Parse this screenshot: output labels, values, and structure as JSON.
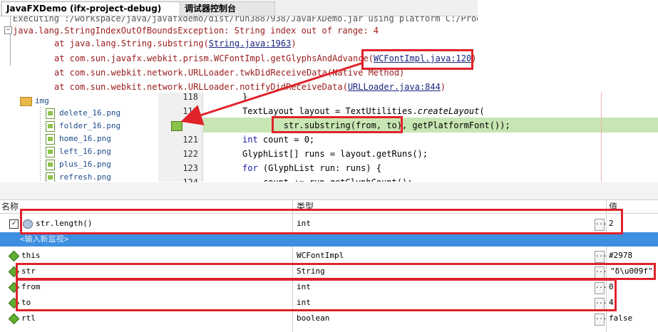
{
  "tabs": [
    {
      "label": "JavaFXDemo (ifx-project-debug)"
    },
    {
      "label": "调试器控制台"
    }
  ],
  "output": {
    "lines": [
      {
        "text": "Executing :/workspace/java/javafxdemo/dist/run3887938/JavaFXDemo.jar using platform C:/Prog"
      },
      {
        "text": "java.lang.StringIndexOutOfBoundsException: String index out of range: 4"
      },
      {
        "prefix": "\tat java.lang.String.substring(",
        "link": "String.java:1963",
        "suffix": ")"
      },
      {
        "prefix": "\tat com.sun.javafx.webkit.prism.WCFontImpl.getGlyphsAndAdvance(",
        "link": "WCFontImpl.java:120",
        "suffix": ")"
      },
      {
        "prefix": "\tat com.sun.webkit.network.URLLoader.twkDidReceiveData(Native Method)",
        "link": "",
        "suffix": ""
      },
      {
        "prefix": "\tat com.sun.webkit.network.URLLoader.notifyDidReceiveData(",
        "link": "URLLoader.java:844",
        "suffix": ")"
      }
    ]
  },
  "tree": {
    "folder": "img",
    "files": [
      "delete_16.png",
      "folder_16.png",
      "home_16.png",
      "left_16.png",
      "plus_16.png",
      "refresh.png"
    ]
  },
  "editor": {
    "line_numbers": [
      "118",
      "119",
      "",
      "121",
      "122",
      "123",
      "124"
    ],
    "lines": [
      {
        "parts": [
          {
            "t": "}",
            "c": ""
          }
        ]
      },
      {
        "parts": [
          {
            "t": "TextLayout layout = TextUtilities.",
            "c": ""
          },
          {
            "t": "createLayout",
            "c": "it"
          },
          {
            "t": "(",
            "c": ""
          }
        ]
      },
      {
        "parts": [
          {
            "t": "        str.substring(from, to), getPlatformFont());",
            "c": ""
          }
        ]
      },
      {
        "parts": [
          {
            "t": "int",
            "c": "kw"
          },
          {
            "t": " count = 0;",
            "c": ""
          }
        ]
      },
      {
        "parts": [
          {
            "t": "GlyphList[] runs = layout.getRuns();",
            "c": ""
          }
        ]
      },
      {
        "parts": [
          {
            "t": "for",
            "c": "kw"
          },
          {
            "t": " (GlyphList run: runs) {",
            "c": ""
          }
        ]
      },
      {
        "parts": [
          {
            "t": "    count += run.getGlyphCount();",
            "c": ""
          }
        ]
      }
    ]
  },
  "watches": {
    "headers": {
      "name": "名称",
      "type": "类型",
      "value": "值"
    },
    "new_watch_placeholder": "<输入新监视>",
    "watch_expression": {
      "name": "str.length()",
      "type": "int",
      "value": "2"
    },
    "rows": [
      {
        "name": "this",
        "type": "WCFontImpl",
        "value": "#2978"
      },
      {
        "name": "str",
        "type": "String",
        "value": "\"δ\\u009f\""
      },
      {
        "name": "from",
        "type": "int",
        "value": "0"
      },
      {
        "name": "to",
        "type": "int",
        "value": "4"
      },
      {
        "name": "rtl",
        "type": "boolean",
        "value": "false"
      }
    ],
    "ellipsis": "..."
  },
  "colors": {
    "annotation": "#e0222b",
    "current_line": "#c8e6b3",
    "selection": "#3d8fe0"
  }
}
